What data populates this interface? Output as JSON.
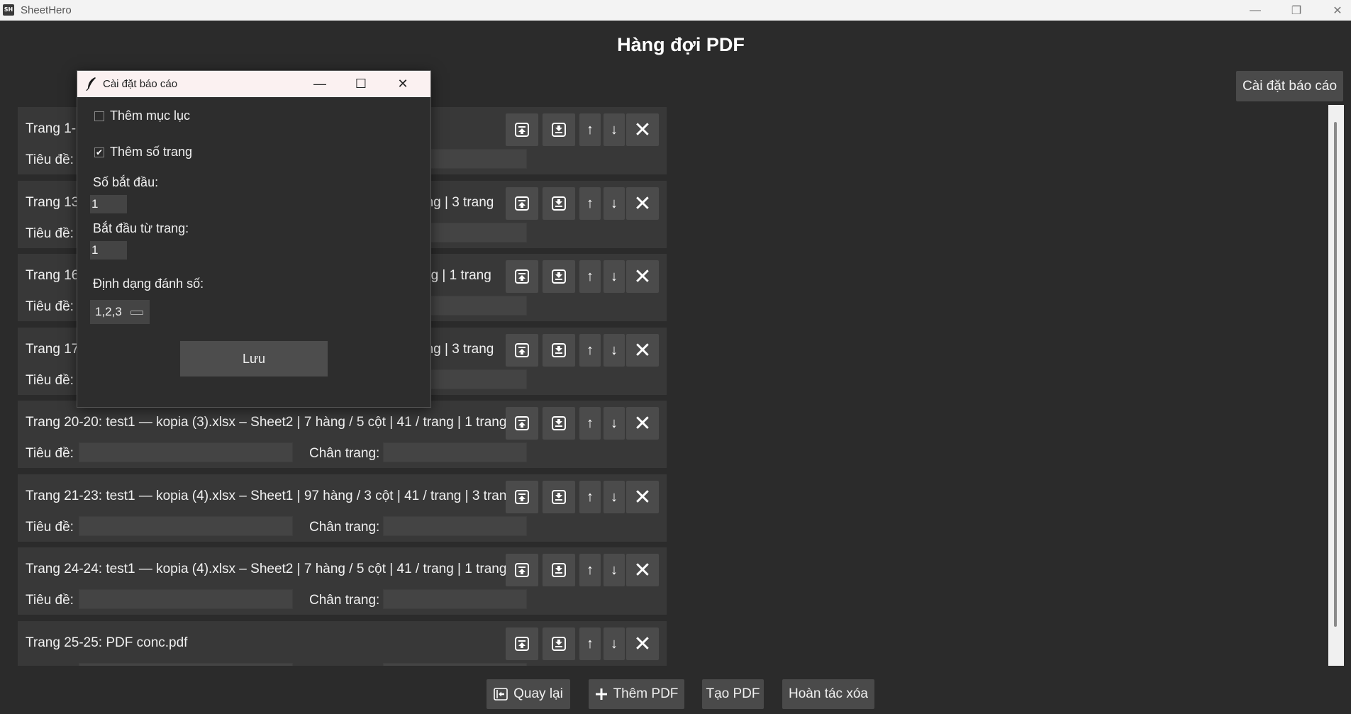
{
  "app": {
    "title": "SheetHero",
    "icon_text": "SH"
  },
  "window_controls": {
    "minimize": "—",
    "restore": "❐",
    "close": "✕"
  },
  "page_title": "Hàng đợi PDF",
  "report_settings_button": "Cài đặt báo cáo",
  "field_labels": {
    "title": "Tiêu đề:",
    "footer": "Chân trang:"
  },
  "card_controls": {
    "up": "↑",
    "down": "↓",
    "remove": "✕"
  },
  "queue_items": [
    {
      "text": "Trang 1-"
    },
    {
      "text": "Trang 13",
      "tail": "ang | 3 trang"
    },
    {
      "text": "Trang 16",
      "tail": "ng | 1 trang"
    },
    {
      "text": "Trang 17",
      "tail": "ang | 3 trang"
    },
    {
      "text": "Trang 20-20: test1 — kopia (3).xlsx – Sheet2 | 7 hàng / 5 cột | 41 / trang | 1 trang"
    },
    {
      "text": "Trang 21-23: test1 — kopia (4).xlsx – Sheet1 | 97 hàng / 3 cột | 41 / trang | 3 trang"
    },
    {
      "text": "Trang 24-24: test1 — kopia (4).xlsx – Sheet2 | 7 hàng / 5 cột | 41 / trang | 1 trang"
    },
    {
      "text": "Trang 25-25: PDF conc.pdf"
    }
  ],
  "bottom_buttons": {
    "back": "Quay lại",
    "add_pdf": "Thêm PDF",
    "create_pdf": "Tạo PDF",
    "undo_delete": "Hoàn tác xóa"
  },
  "dialog": {
    "title": "Cài đặt báo cáo",
    "controls": {
      "minimize": "—",
      "maximize": "☐",
      "close": "✕"
    },
    "add_toc": {
      "label": "Thêm mục lục",
      "checked": false
    },
    "add_page_numbers": {
      "label": "Thêm số trang",
      "checked": true,
      "mark": "✔"
    },
    "start_number": {
      "label": "Số bắt đầu:",
      "value": "1"
    },
    "start_from_page": {
      "label": "Bắt đầu từ trang:",
      "value": "1"
    },
    "numbering_format": {
      "label": "Định dạng đánh số:",
      "value": "1,2,3"
    },
    "save_button": "Lưu"
  }
}
